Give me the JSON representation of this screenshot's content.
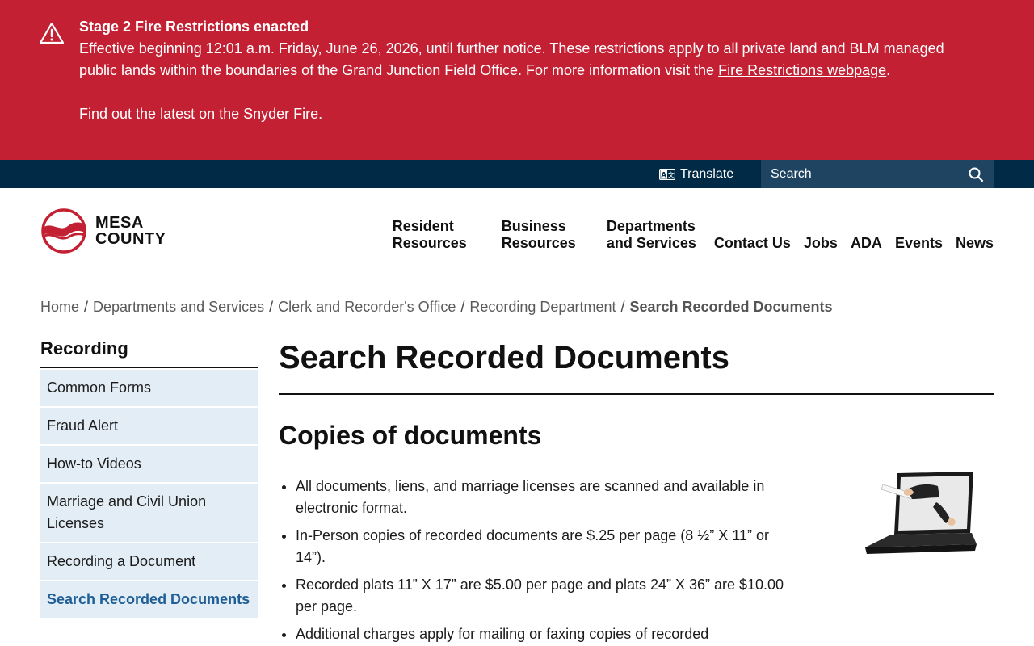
{
  "alert": {
    "title": "Stage 2 Fire Restrictions enacted",
    "text": "Effective beginning 12:01 a.m. Friday, June 26, 2026, until further notice. These restrictions apply to all private land and BLM managed public lands within the boundaries of the Grand Junction Field Office. For more information visit the ",
    "link1": "Fire Restrictions webpage",
    "period1": ".",
    "link2": "Find out the latest on the Snyder Fire",
    "period2": "."
  },
  "utility": {
    "translate_label": "Translate",
    "search_placeholder": "Search"
  },
  "logo": {
    "line1": "MESA",
    "line2": "COUNTY"
  },
  "nav": {
    "items": [
      {
        "line1": "Resident",
        "line2": "Resources"
      },
      {
        "line1": "Business",
        "line2": "Resources"
      },
      {
        "line1": "Departments",
        "line2": "and Services"
      },
      {
        "line1": "Contact Us"
      },
      {
        "line1": "Jobs"
      },
      {
        "line1": "ADA"
      },
      {
        "line1": "Events"
      },
      {
        "line1": "News"
      }
    ]
  },
  "breadcrumb": {
    "links": [
      "Home",
      "Departments and Services",
      "Clerk and Recorder's Office",
      "Recording Department"
    ],
    "current": "Search Recorded Documents",
    "separator": "/"
  },
  "sidebar": {
    "title": "Recording",
    "items": [
      {
        "label": "Common Forms"
      },
      {
        "label": "Fraud Alert"
      },
      {
        "label": "How-to Videos"
      },
      {
        "label": "Marriage and Civil Union Licenses"
      },
      {
        "label": "Recording a Document"
      },
      {
        "label": "Search Recorded Documents",
        "active": true
      }
    ]
  },
  "main": {
    "title": "Search Recorded Documents",
    "section_title": "Copies of documents",
    "bullets": [
      "All documents, liens, and marriage licenses are scanned and available in electronic format.",
      "In-Person copies of recorded documents are $.25 per page (8 ½” X 11” or 14”).",
      "Recorded plats 11” X 17” are $5.00 per page and plats 24” X 36” are $10.00 per page.",
      "Additional charges apply for mailing or faxing copies of recorded"
    ]
  },
  "colors": {
    "alert_bg": "#c32033",
    "utility_bg": "#002a45",
    "search_bg": "#1f4461",
    "sidebar_bg": "#e3edf5",
    "active_link": "#1f5e96",
    "logo_red": "#c32033"
  }
}
